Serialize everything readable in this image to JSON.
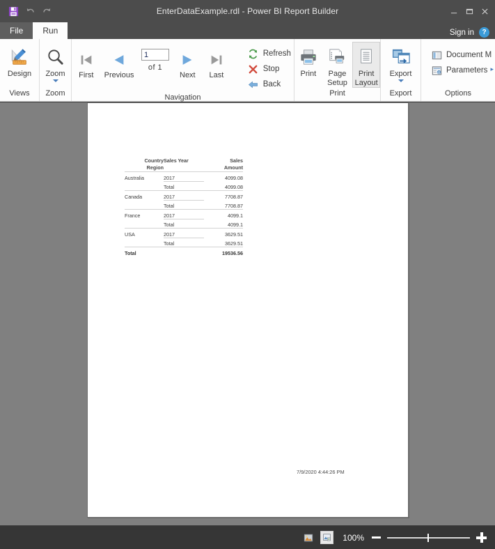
{
  "window": {
    "title": "EnterDataExample.rdl - Power BI Report Builder",
    "minimize_label": "—",
    "maximize_label": "▭",
    "close_label": "✕"
  },
  "quick_access": {
    "save": "save-icon",
    "undo": "undo-icon",
    "redo": "redo-icon"
  },
  "tabs": [
    {
      "label": "File",
      "active": false
    },
    {
      "label": "Run",
      "active": true
    }
  ],
  "account": {
    "sign_in_label": "Sign in",
    "help_label": "?"
  },
  "ribbon": {
    "groups": [
      {
        "name": "Views",
        "label": "Views",
        "items": [
          {
            "label": "Design",
            "icon": "design-ruler-pencil-icon"
          }
        ]
      },
      {
        "name": "Zoom",
        "label": "Zoom",
        "items": [
          {
            "label": "Zoom",
            "icon": "magnifier-icon",
            "has_dropdown": true
          }
        ]
      },
      {
        "name": "Navigation",
        "label": "Navigation",
        "items": [
          {
            "label": "First",
            "icon": "first-page-icon",
            "enabled": false
          },
          {
            "label": "Previous",
            "icon": "previous-page-icon",
            "enabled": false
          },
          {
            "label": "Next",
            "icon": "next-page-icon",
            "enabled": false
          },
          {
            "label": "Last",
            "icon": "last-page-icon",
            "enabled": false
          },
          {
            "label": "Refresh",
            "icon": "refresh-icon"
          },
          {
            "label": "Stop",
            "icon": "stop-icon"
          },
          {
            "label": "Back",
            "icon": "back-arrow-icon"
          }
        ],
        "page_input_value": "1",
        "page_of_label": "of  1"
      },
      {
        "name": "Print",
        "label": "Print",
        "items": [
          {
            "label": "Print",
            "icon": "printer-icon"
          },
          {
            "label": "Page Setup",
            "label_line1": "Page",
            "label_line2": "Setup",
            "icon": "page-setup-icon"
          },
          {
            "label": "Print Layout",
            "label_line1": "Print",
            "label_line2": "Layout",
            "icon": "print-layout-icon",
            "selected": true
          }
        ]
      },
      {
        "name": "Export",
        "label": "Export",
        "items": [
          {
            "label": "Export",
            "icon": "export-icon",
            "has_dropdown": true
          }
        ]
      },
      {
        "name": "Options",
        "label": "Options",
        "items": [
          {
            "label": "Document M",
            "icon": "document-map-icon"
          },
          {
            "label": "Parameters",
            "icon": "parameters-icon"
          }
        ],
        "overflow_label": "▸"
      }
    ]
  },
  "report": {
    "table": {
      "headers": [
        "Country Region",
        "Sales Year",
        "Sales Amount"
      ],
      "header_lines": [
        [
          "Country",
          "Region"
        ],
        [
          "Sales Year",
          ""
        ],
        [
          "Sales",
          "Amount"
        ]
      ],
      "rows": [
        {
          "country": "Australia",
          "year": "2017",
          "amount": "4099.08",
          "type": "detail"
        },
        {
          "country": "",
          "year": "Total",
          "amount": "4099.08",
          "type": "subtotal"
        },
        {
          "country": "Canada",
          "year": "2017",
          "amount": "7708.87",
          "type": "detail"
        },
        {
          "country": "",
          "year": "Total",
          "amount": "7708.87",
          "type": "subtotal"
        },
        {
          "country": "France",
          "year": "2017",
          "amount": "4099.1",
          "type": "detail"
        },
        {
          "country": "",
          "year": "Total",
          "amount": "4099.1",
          "type": "subtotal"
        },
        {
          "country": "USA",
          "year": "2017",
          "amount": "3629.51",
          "type": "detail"
        },
        {
          "country": "",
          "year": "Total",
          "amount": "3629.51",
          "type": "subtotal"
        }
      ],
      "grand_total": {
        "label": "Total",
        "amount": "19536.56"
      }
    },
    "timestamp": "7/9/2020 4:44:26 PM"
  },
  "statusbar": {
    "view_print_layout_icon": "page-view-icon",
    "view_normal_icon": "normal-view-icon",
    "zoom_level": "100%",
    "zoom_out_label": "−",
    "zoom_in_label": "+"
  }
}
